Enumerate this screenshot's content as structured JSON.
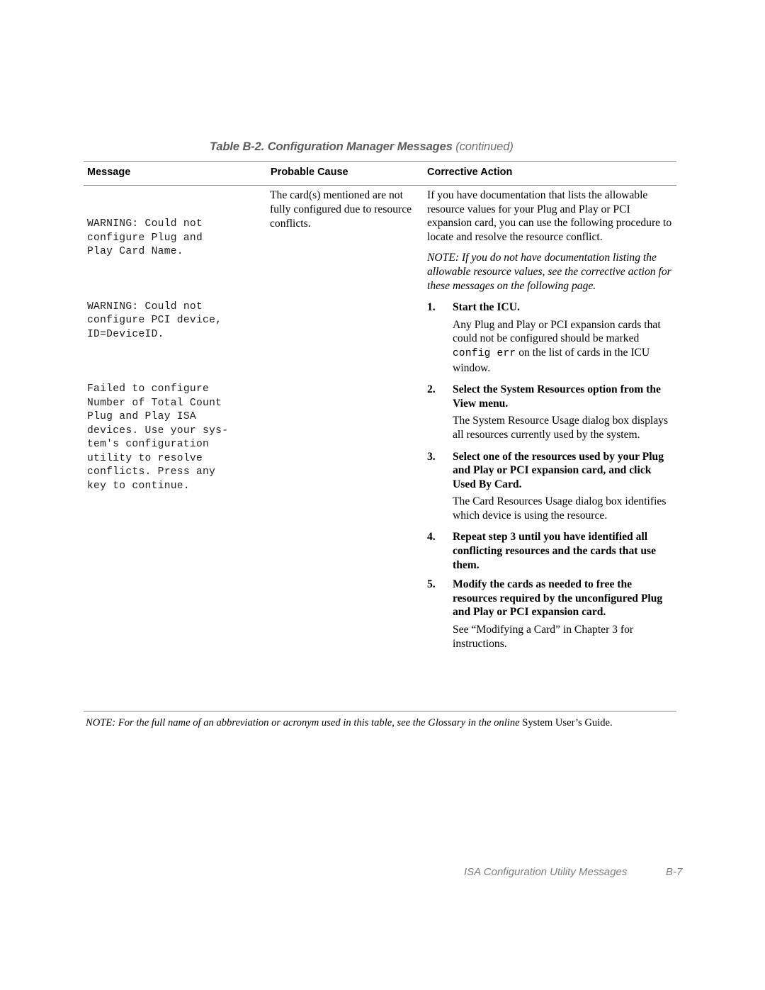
{
  "table": {
    "caption_main": "Table B-2.  Configuration Manager Messages",
    "caption_continued": "(continued)",
    "columns": {
      "message": "Message",
      "probable_cause": "Probable Cause",
      "corrective_action": "Corrective Action"
    },
    "messages": [
      "WARNING: Could not\nconfigure Plug and\nPlay Card Name.",
      "WARNING: Could not\nconfigure PCI device,\nID=DeviceID.",
      "Failed to configure\nNumber of Total Count\nPlug and Play ISA\ndevices. Use your sys-\ntem's configuration\nutility to resolve\nconflicts. Press any\nkey to continue."
    ],
    "probable_cause_text": "The card(s) mentioned are not fully configured due to resource conflicts.",
    "corrective_action": {
      "intro": "If you have documentation that lists the allowable resource values for your Plug and Play or PCI expansion card, you can use the following procedure to locate and resolve the resource conflict.",
      "note": "NOTE: If you do not have documentation listing the allowable resource values, see the corrective action for these messages on the following page.",
      "steps": [
        {
          "number": "1.",
          "title": "Start the ICU.",
          "body_before": "Any Plug and Play or PCI expansion cards that could not be configured should be marked ",
          "body_mono": "config err",
          "body_after": " on the list of cards in the ICU window."
        },
        {
          "number": "2.",
          "title": "Select the System Resources option from the View menu.",
          "body": "The System Resource Usage dialog box displays all resources currently used by the system."
        },
        {
          "number": "3.",
          "title": "Select one of the resources used by your Plug and Play or PCI expansion card, and click Used By Card.",
          "body": "The Card Resources Usage dialog box identifies which device is using the resource."
        },
        {
          "number": "4.",
          "title": "Repeat step 3 until you have identified all conflicting resources and the cards that use them.",
          "body": ""
        },
        {
          "number": "5.",
          "title": "Modify the cards as needed to free the resources required by the unconfigured Plug and Play or PCI expansion card.",
          "body": "See “Modifying a Card” in Chapter 3 for instructions."
        }
      ]
    },
    "footnote_italic": "NOTE: For the full name of an abbreviation or acronym used in this table, see the Glossary in the online ",
    "footnote_roman": "System User’s Guide."
  },
  "footer": {
    "chapter_name": "ISA Configuration Utility Messages",
    "page_number": "B-7"
  },
  "colors": {
    "rule": "#8a8a8a",
    "caption": "#5b5b5b",
    "footer_text": "#77807a",
    "body_text": "#000000"
  }
}
